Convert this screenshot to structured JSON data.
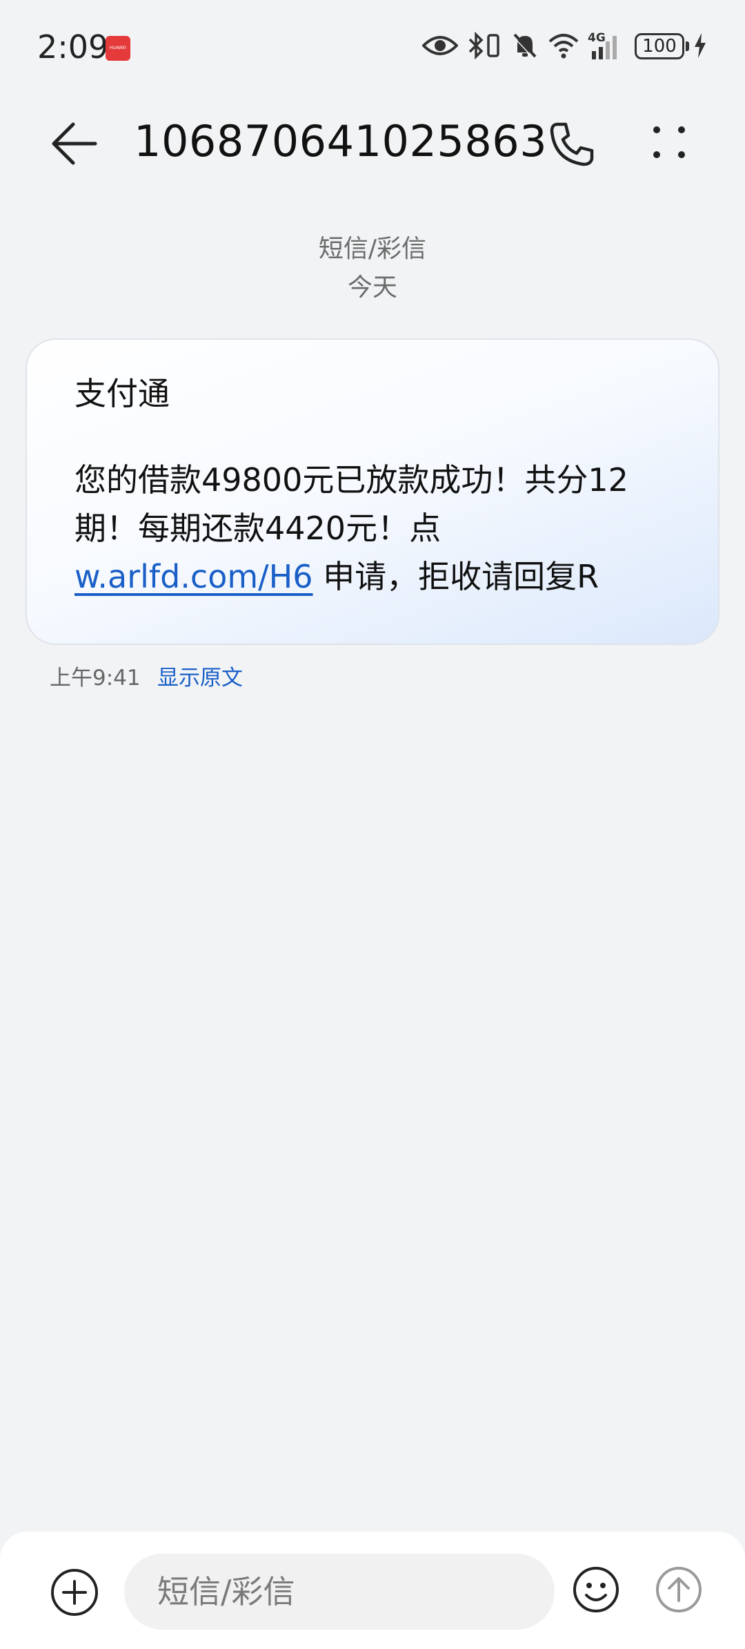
{
  "status_bar": {
    "time": "2:09",
    "app_badge": "HUAWEI",
    "icons": [
      "eye-icon",
      "bluetooth-icon",
      "vibrate-icon",
      "mute-bell-icon",
      "wifi-icon",
      "signal-4g-icon",
      "battery-icon",
      "charging-icon"
    ],
    "network": "4G",
    "battery": "100"
  },
  "header": {
    "title": "106870641025863"
  },
  "thread": {
    "type": "短信/彩信",
    "date": "今天"
  },
  "message": {
    "sender": "支付通",
    "body_before_link": "您的借款49800元已放款成功！共分12期！每期还款4420元！点 ",
    "link": "w.arlfd.com/H6",
    "body_after_link": " 申请，拒收请回复R",
    "time": "上午9:41",
    "show_original": "显示原文"
  },
  "composer": {
    "placeholder": "短信/彩信"
  },
  "colors": {
    "background": "#f1f3f5",
    "link": "#1a5fc7",
    "badge": "#e53a3a"
  }
}
